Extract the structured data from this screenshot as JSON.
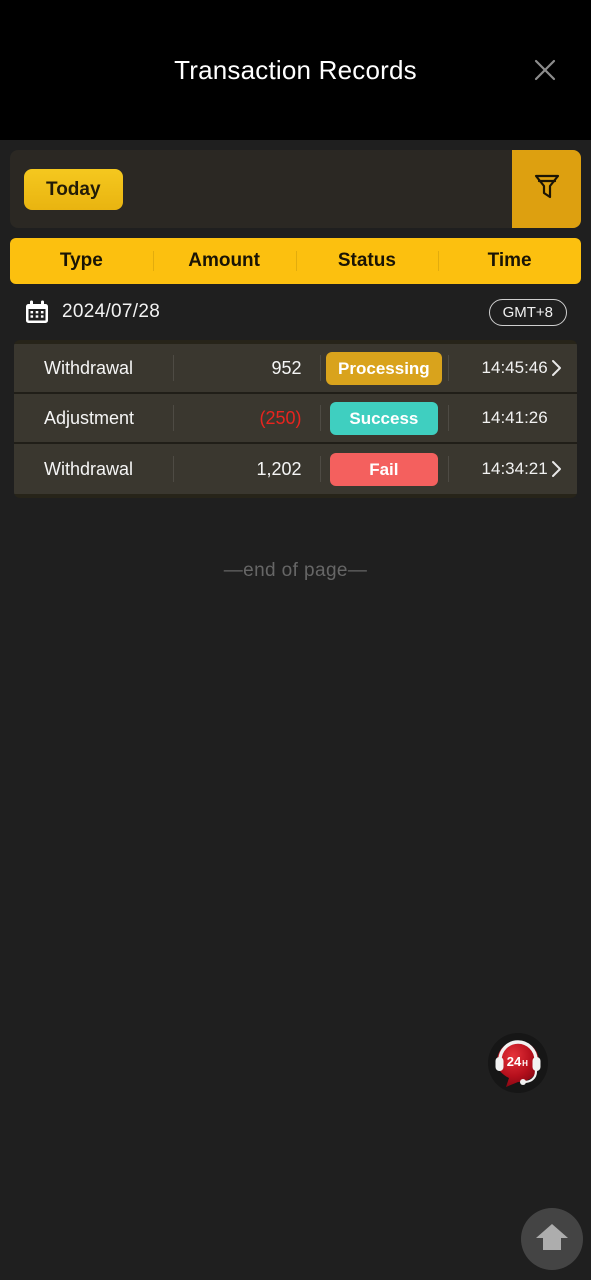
{
  "titlebar": {
    "title": "Transaction Records",
    "close_icon": "close-icon"
  },
  "filter_bar": {
    "today_label": "Today",
    "filter_icon": "funnel-icon"
  },
  "table": {
    "columns": [
      "Type",
      "Amount",
      "Status",
      "Time"
    ]
  },
  "date_group": {
    "calendar_icon": "calendar-icon",
    "date": "2024/07/28",
    "timezone": "GMT+8"
  },
  "records": [
    {
      "type": "Withdrawal",
      "amount": "952",
      "negative": false,
      "status": "Processing",
      "status_kind": "processing",
      "time": "14:45:46",
      "has_chevron": true
    },
    {
      "type": "Adjustment",
      "amount": "(250)",
      "negative": true,
      "status": "Success",
      "status_kind": "success",
      "time": "14:41:26",
      "has_chevron": false
    },
    {
      "type": "Withdrawal",
      "amount": "1,202",
      "negative": false,
      "status": "Fail",
      "status_kind": "fail",
      "time": "14:34:21",
      "has_chevron": true
    }
  ],
  "footer": {
    "end_of_page": "—end of page—"
  },
  "support_widget": {
    "icon": "headset-support-icon",
    "label": "24",
    "label_suffix": "H"
  },
  "home_button": {
    "icon": "home-icon"
  },
  "colors": {
    "page_background": "#1f1f1f",
    "titlebar_background": "#000000",
    "accent_gold": "#fcc00f",
    "filter_button": "#dda010",
    "row_background": "#3a372f",
    "status_processing": "#d9a31c",
    "status_success": "#3fcfc0",
    "status_fail": "#f4605e",
    "negative_amount": "#e8241e",
    "support_red": "#c1121f"
  }
}
